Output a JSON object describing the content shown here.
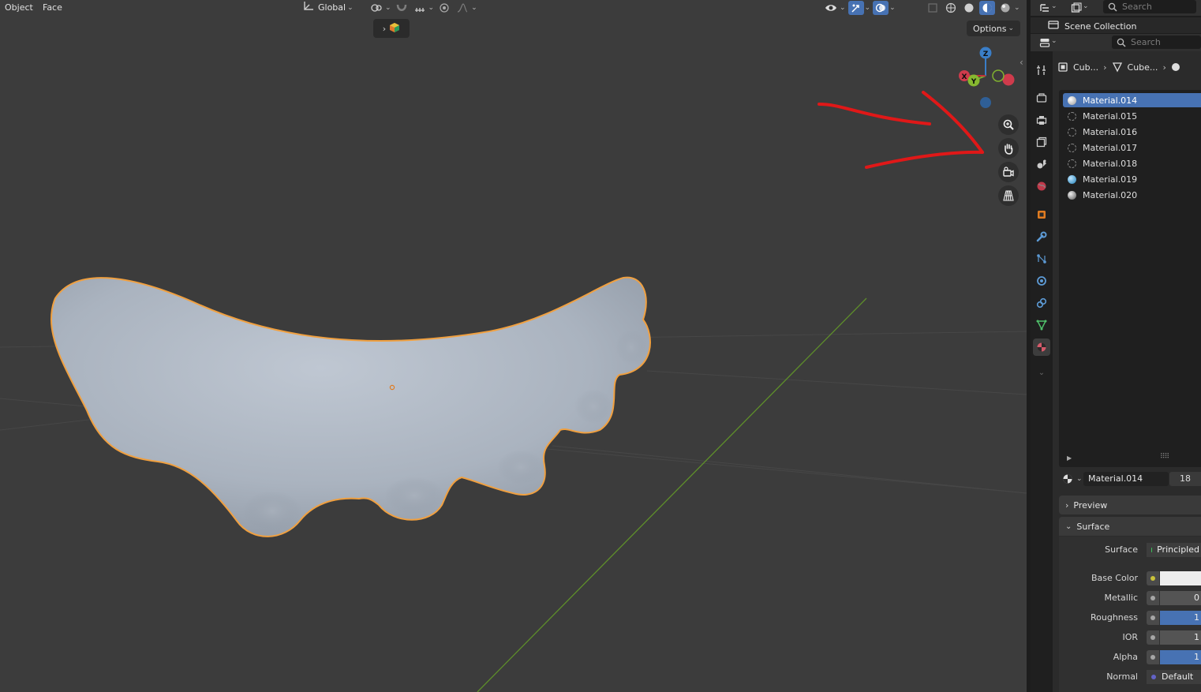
{
  "viewport_header": {
    "menus": [
      "Object",
      "Face"
    ],
    "transform_orientation": "Global",
    "options_label": "Options"
  },
  "gizmo": {
    "z": "Z",
    "y": "Y",
    "x": "X"
  },
  "outliner": {
    "search_placeholder": "Search",
    "scene_collection": "Scene Collection"
  },
  "properties": {
    "search_placeholder": "Search",
    "breadcrumb": [
      "Cub...",
      "Cube..."
    ],
    "material_slots": [
      {
        "name": "Material.014",
        "color": "#c9c9c9",
        "active": true
      },
      {
        "name": "Material.015",
        "color": "none",
        "active": false
      },
      {
        "name": "Material.016",
        "color": "none",
        "active": false
      },
      {
        "name": "Material.017",
        "color": "none",
        "active": false
      },
      {
        "name": "Material.018",
        "color": "none",
        "active": false
      },
      {
        "name": "Material.019",
        "color": "#2a8fc7",
        "active": false
      },
      {
        "name": "Material.020",
        "color": "#9a9a9a",
        "active": false
      }
    ],
    "material_name": "Material.014",
    "material_users": "18",
    "preview_label": "Preview",
    "surface_panel_label": "Surface",
    "surface": {
      "surface": {
        "label": "Surface",
        "value": "Principled"
      },
      "base_color": {
        "label": "Base Color",
        "value": "#ededed"
      },
      "metallic": {
        "label": "Metallic",
        "value": "0"
      },
      "roughness": {
        "label": "Roughness",
        "value": "1"
      },
      "ior": {
        "label": "IOR",
        "value": "1"
      },
      "alpha": {
        "label": "Alpha",
        "value": "1"
      },
      "normal": {
        "label": "Normal",
        "value": "Default"
      }
    }
  },
  "colors": {
    "accent": "#4772b3",
    "selection_outline": "#f0a040",
    "annotation": "#e01818",
    "axis_y": "#6aa32a"
  }
}
